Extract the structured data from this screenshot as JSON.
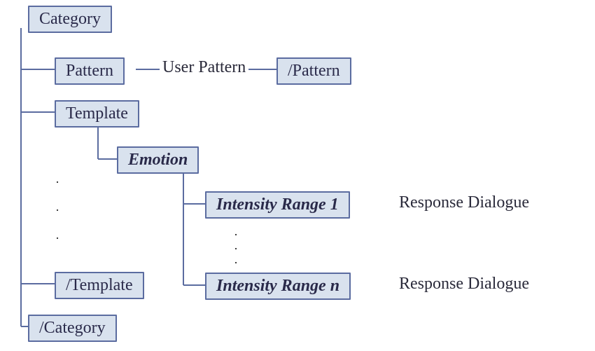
{
  "nodes": {
    "category": "Category",
    "pattern": "Pattern",
    "pattern_close": "/Pattern",
    "template": "Template",
    "emotion": "Emotion",
    "intensity1": "Intensity Range 1",
    "intensityn": "Intensity Range n",
    "template_close": "/Template",
    "category_close": "/Category"
  },
  "labels": {
    "user_pattern": "User Pattern",
    "response1": "Response Dialogue",
    "responsen": "Response Dialogue"
  }
}
